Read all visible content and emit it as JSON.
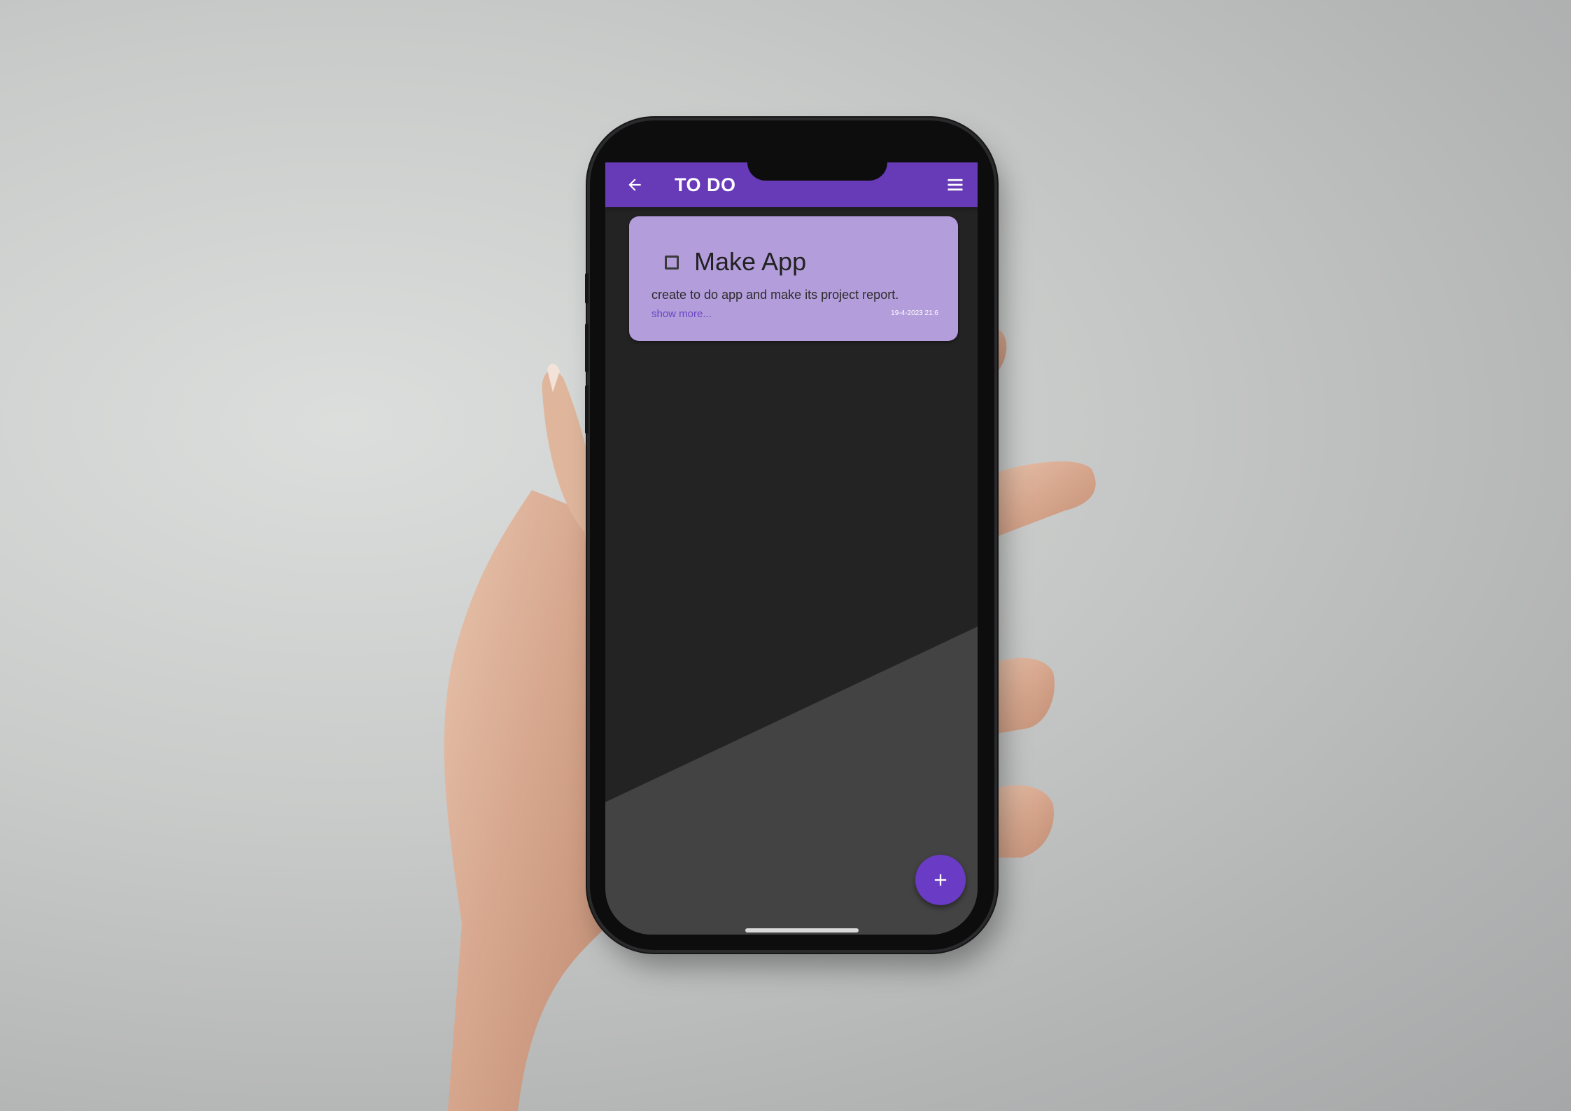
{
  "app_bar": {
    "title": "TO DO",
    "background_color": "#673ab7",
    "back_icon": "arrow-back-icon",
    "menu_icon": "hamburger-menu-icon"
  },
  "tasks": [
    {
      "title": "Make App",
      "description": "create to do app and make its project report.",
      "show_more_label": "show more...",
      "date": "19-4-2023  21:6",
      "checked": false,
      "card_color": "#b39ddb"
    }
  ],
  "fab": {
    "icon": "plus-icon",
    "color": "#6a3bc4"
  }
}
